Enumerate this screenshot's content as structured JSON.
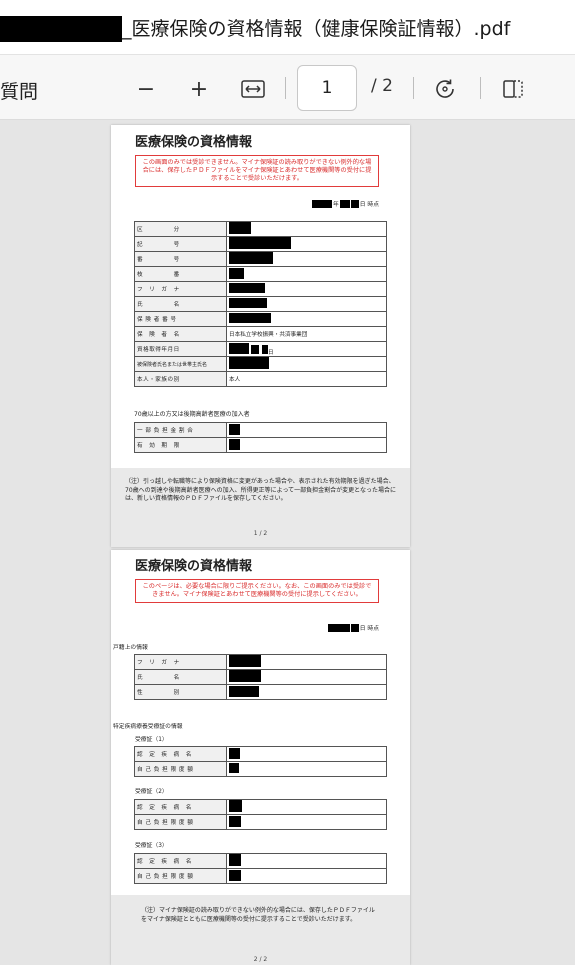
{
  "window": {
    "file_title": "_医療保険の資格情報（健康保険証情報）.pdf"
  },
  "toolbar": {
    "left_label": "質問",
    "zoom_out": "−",
    "zoom_in": "+",
    "fit": "↔",
    "page_current": "1",
    "page_total": "/ 2"
  },
  "page1": {
    "title": "医療保険の資格情報",
    "notice": "この画面のみでは受診できません。マイナ保険証の読み取りができない例外的な場合には、保存したＰＤＦファイルをマイナ保険証とあわせて医療機関等の受付に提示することで受診いただけます。",
    "asof_y": "年",
    "asof_d": "日 時点",
    "rows": [
      {
        "label": "区　　　　　分",
        "value": ""
      },
      {
        "label": "記　　　　　号",
        "value": ""
      },
      {
        "label": "番　　　　　号",
        "value": ""
      },
      {
        "label": "枝　　　　　番",
        "value": ""
      },
      {
        "label": "フ　リ　ガ　ナ",
        "value": ""
      },
      {
        "label": "氏　　　　　名",
        "value": ""
      },
      {
        "label": "保 険 者 番 号",
        "value": ""
      },
      {
        "label": "保　険　者　名",
        "value": "日本私立学校振興・共済事業団"
      },
      {
        "label": "資格取得年月日",
        "value": "日"
      },
      {
        "label": "被保険者氏名または世帯主氏名",
        "value": ""
      },
      {
        "label": "本人・家族の別",
        "value": "本人"
      }
    ],
    "section70": "70歳以上の方又は後期高齢者医療の加入者",
    "rows70": [
      {
        "label": "一 部 負 担 金 割 合",
        "value": ""
      },
      {
        "label": "有　効　期　限",
        "value": ""
      }
    ],
    "footnote": "（注）引っ越しや転職等により保険資格に変更があった場合や、表示された有効期限を過ぎた場合、70歳への到達や後期高齢者医療への加入、所得更正等によって一部負担金割合が変更となった場合には、新しい資格情報のＰＤＦファイルを保存してください。",
    "page_num": "1 / 2"
  },
  "page2": {
    "title": "医療保険の資格情報",
    "notice": "このページは、必要な場合に限りご提示ください。なお、この画面のみでは受診できません。マイナ保険証とあわせて医療機関等の受付に提示してください。",
    "asof_d": "日 時点",
    "koseki_heading": "戸籍上の情報",
    "koseki_rows": [
      {
        "label": "フ　リ　ガ　ナ"
      },
      {
        "label": "氏　　　　　名"
      },
      {
        "label": "性　　　　　別"
      }
    ],
    "tokutei_heading": "特定疾病療養受療証の情報",
    "groups": [
      {
        "title": "受療証（1）",
        "rows": [
          {
            "label": "認　定　疾　病　名"
          },
          {
            "label": "自 己 負 担 限 度 額"
          }
        ]
      },
      {
        "title": "受療証（2）",
        "rows": [
          {
            "label": "認　定　疾　病　名"
          },
          {
            "label": "自 己 負 担 限 度 額"
          }
        ]
      },
      {
        "title": "受療証（3）",
        "rows": [
          {
            "label": "認　定　疾　病　名"
          },
          {
            "label": "自 己 負 担 限 度 額"
          }
        ]
      }
    ],
    "footnote": "（注）マイナ保険証の読み取りができない例外的な場合には、保存したＰＤＦファイルをマイナ保険証とともに医療機関等の受付に提示することで受診いただけます。",
    "page_num": "2 / 2"
  }
}
